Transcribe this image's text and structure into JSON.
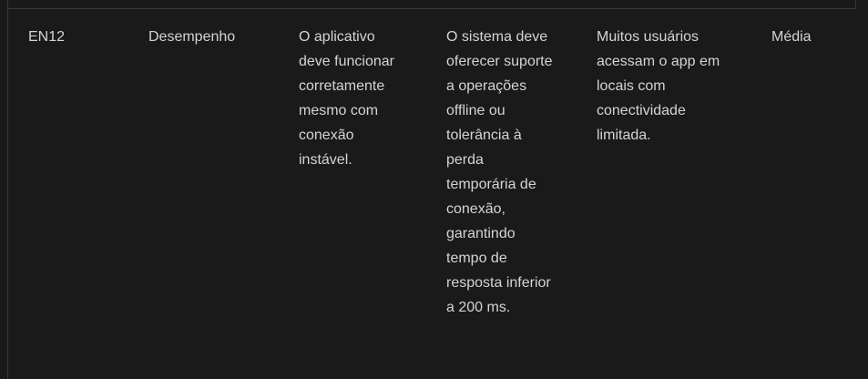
{
  "table": {
    "rows": [
      {
        "id": "EN12",
        "category": "Desempenho",
        "requirement": "O aplicativo deve funcionar corretamente mesmo com conexão instável.",
        "specification": "O sistema deve oferecer suporte a operações offline ou tolerância à perda temporária de conexão, garantindo tempo de resposta inferior a 200 ms.",
        "justification": "Muitos usuários acessam o app em locais com conectividade limitada.",
        "priority": "Média"
      }
    ]
  }
}
